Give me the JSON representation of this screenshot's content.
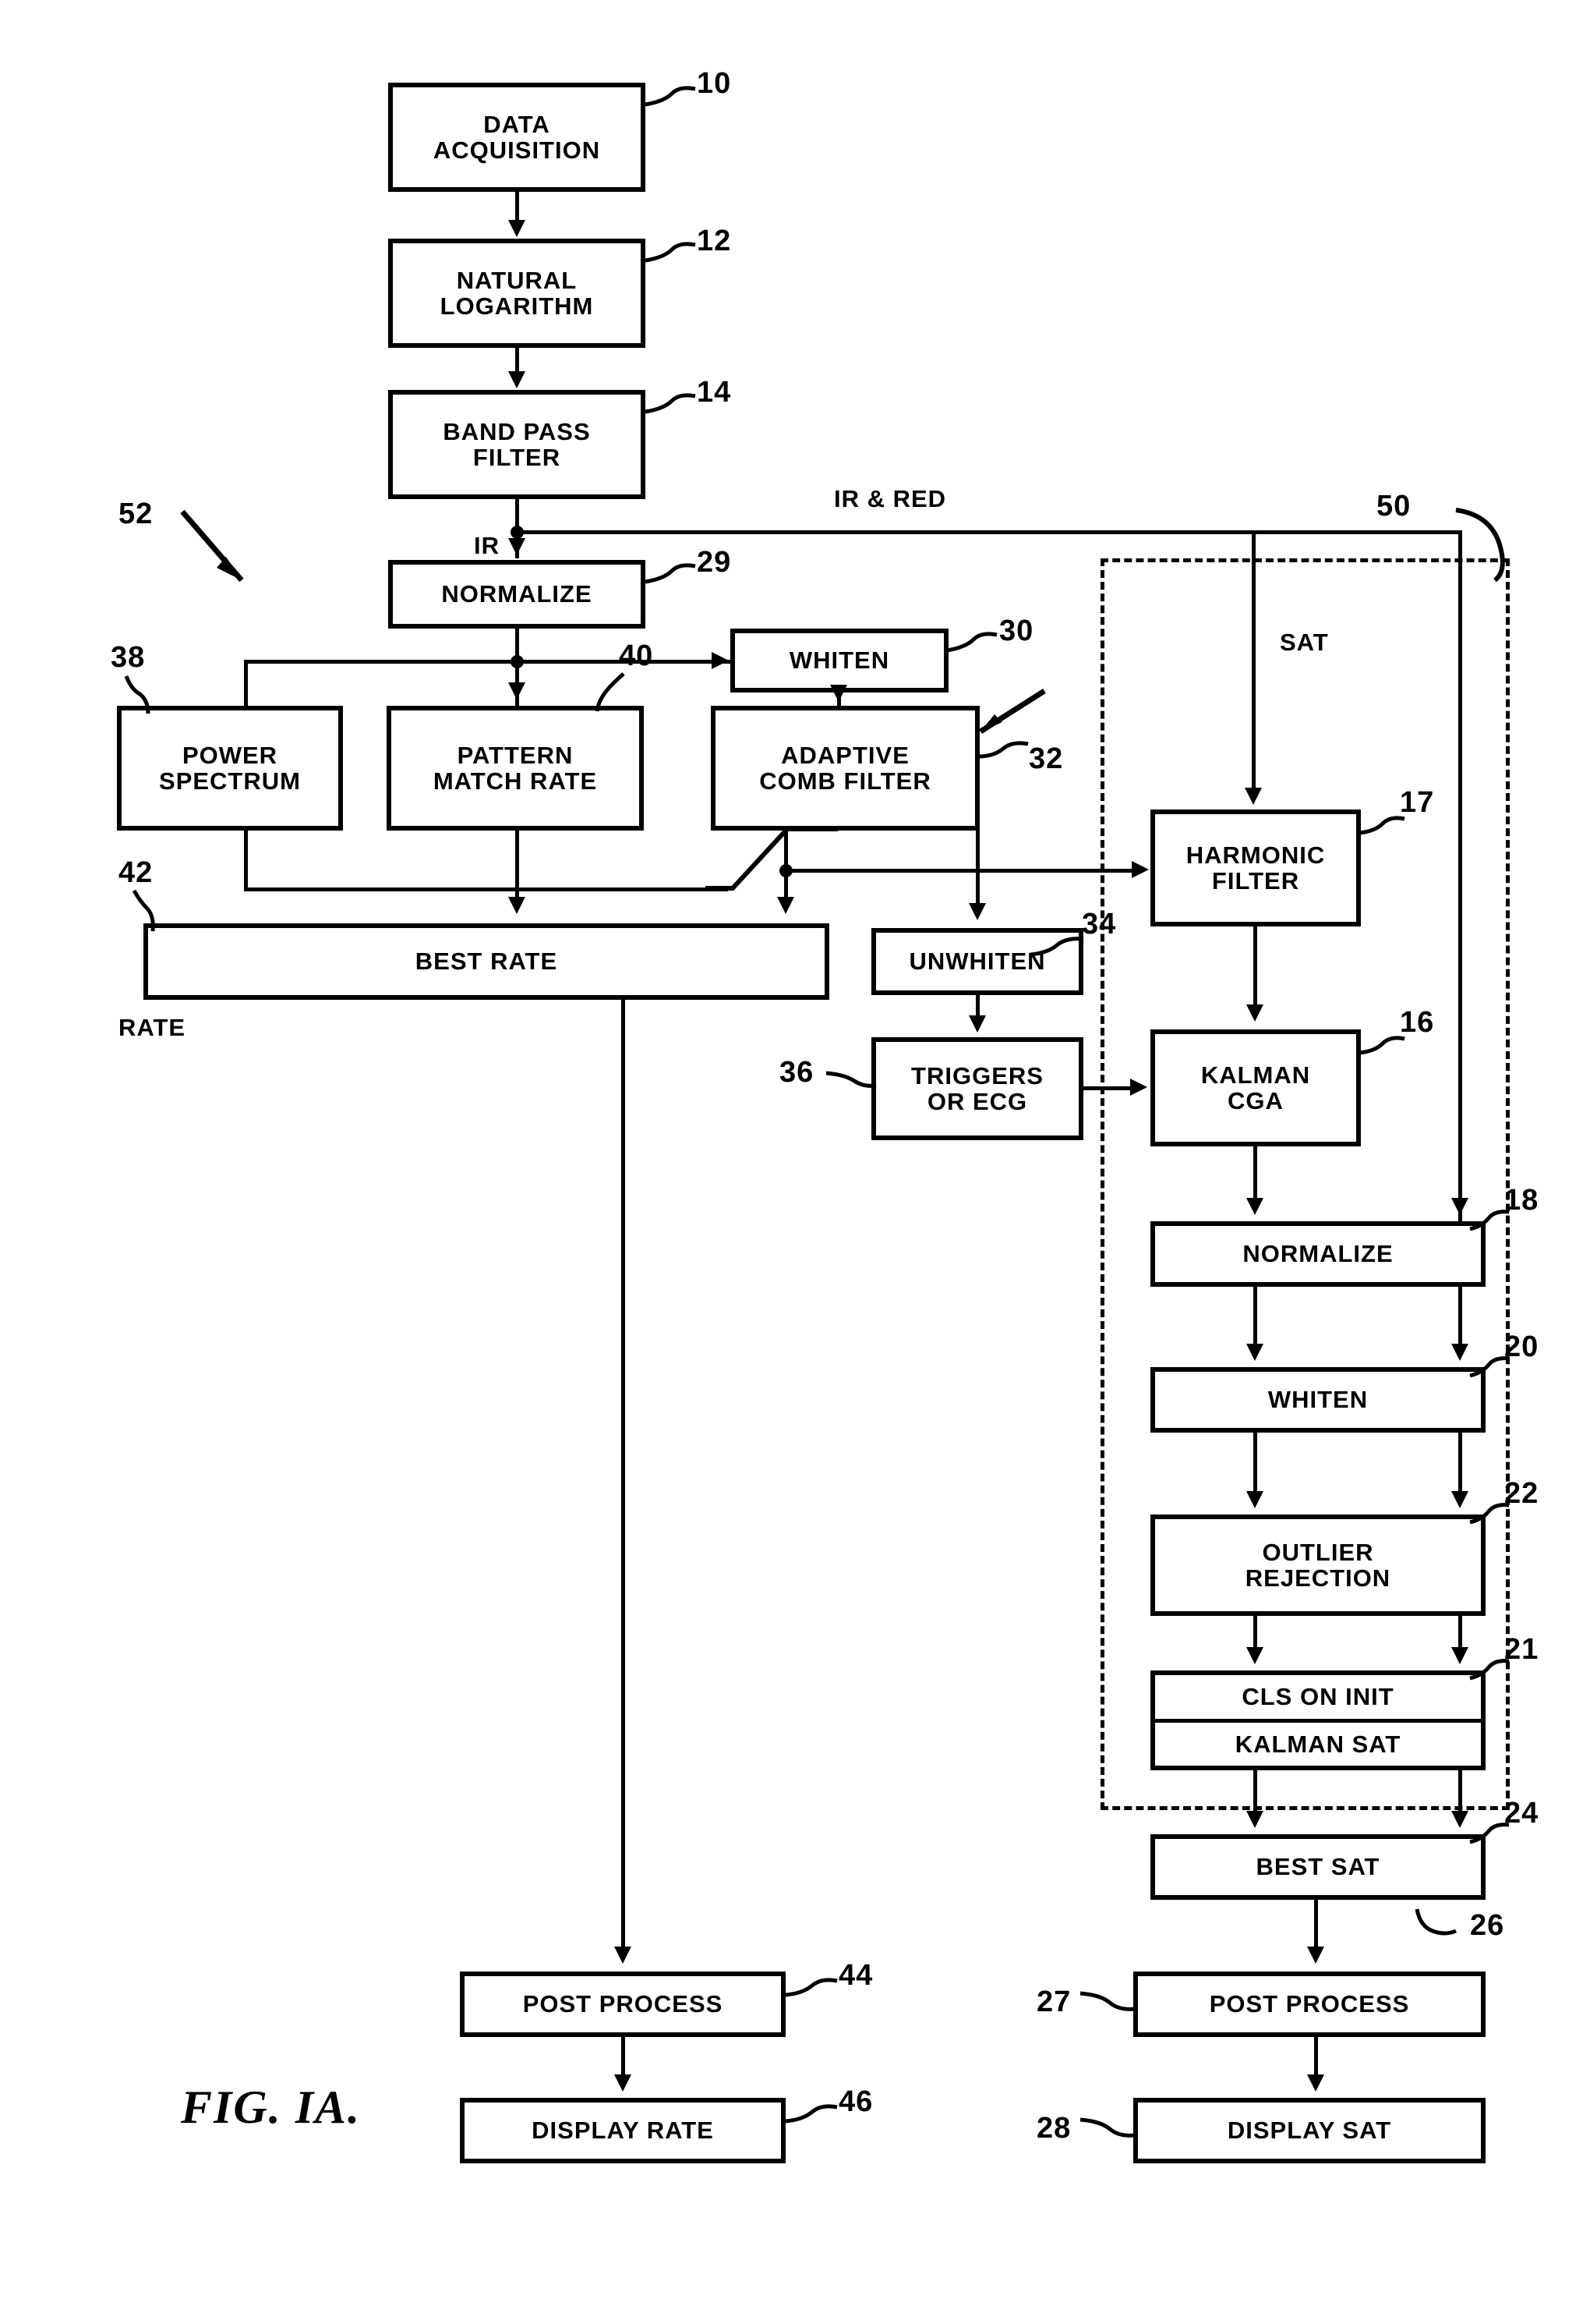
{
  "figure": {
    "caption": "FIG. IA.",
    "rate_branch_label": "RATE",
    "sat_branch_label": "SAT",
    "signal_label_ir": "IR",
    "signal_label_ir_red": "IR & RED"
  },
  "blocks": [
    {
      "id": "data-acquisition",
      "ref": "10",
      "line1": "DATA",
      "line2": "ACQUISITION"
    },
    {
      "id": "natural-logarithm",
      "ref": "12",
      "line1": "NATURAL",
      "line2": "LOGARITHM"
    },
    {
      "id": "band-pass-filter",
      "ref": "14",
      "line1": "BAND PASS",
      "line2": "FILTER"
    },
    {
      "id": "normalize-ir",
      "ref": "29",
      "line1": "NORMALIZE",
      "line2": ""
    },
    {
      "id": "whiten-rate",
      "ref": "30",
      "line1": "WHITEN",
      "line2": ""
    },
    {
      "id": "power-spectrum",
      "ref": "38",
      "line1": "POWER",
      "line2": "SPECTRUM"
    },
    {
      "id": "pattern-match-rate",
      "ref": "40",
      "line1": "PATTERN",
      "line2": "MATCH RATE"
    },
    {
      "id": "adaptive-comb-filter",
      "ref": "32",
      "line1": "ADAPTIVE",
      "line2": "COMB FILTER"
    },
    {
      "id": "best-rate",
      "ref": "42",
      "line1": "BEST RATE",
      "line2": ""
    },
    {
      "id": "unwhiten",
      "ref": "34",
      "line1": "UNWHITEN",
      "line2": ""
    },
    {
      "id": "triggers-or-ecg",
      "ref": "36",
      "line1": "TRIGGERS",
      "line2": "OR ECG"
    },
    {
      "id": "harmonic-filter",
      "ref": "17",
      "line1": "HARMONIC",
      "line2": "FILTER"
    },
    {
      "id": "kalman-cga",
      "ref": "16",
      "line1": "KALMAN",
      "line2": "CGA"
    },
    {
      "id": "normalize-sat",
      "ref": "18",
      "line1": "NORMALIZE",
      "line2": ""
    },
    {
      "id": "whiten-sat",
      "ref": "20",
      "line1": "WHITEN",
      "line2": ""
    },
    {
      "id": "outlier-rejection",
      "ref": "22",
      "line1": "OUTLIER",
      "line2": "REJECTION"
    },
    {
      "id": "cls-kalman-sat",
      "ref": "21",
      "line1": "CLS ON INIT",
      "line2": "KALMAN SAT"
    },
    {
      "id": "best-sat",
      "ref": "24",
      "line1": "BEST SAT",
      "line2": ""
    },
    {
      "id": "post-process-rate",
      "ref": "44",
      "line1": "POST PROCESS",
      "line2": ""
    },
    {
      "id": "display-rate",
      "ref": "46",
      "line1": "DISPLAY RATE",
      "line2": ""
    },
    {
      "id": "post-process-sat",
      "ref": "27",
      "line1": "POST PROCESS",
      "line2": ""
    },
    {
      "id": "display-sat",
      "ref": "28",
      "line1": "DISPLAY SAT",
      "line2": ""
    }
  ],
  "group_refs": {
    "rate_processing": "52",
    "sat_processing": "50",
    "best_sat_output": "26"
  },
  "colors": {
    "ink": "#000000",
    "paper": "#ffffff"
  }
}
